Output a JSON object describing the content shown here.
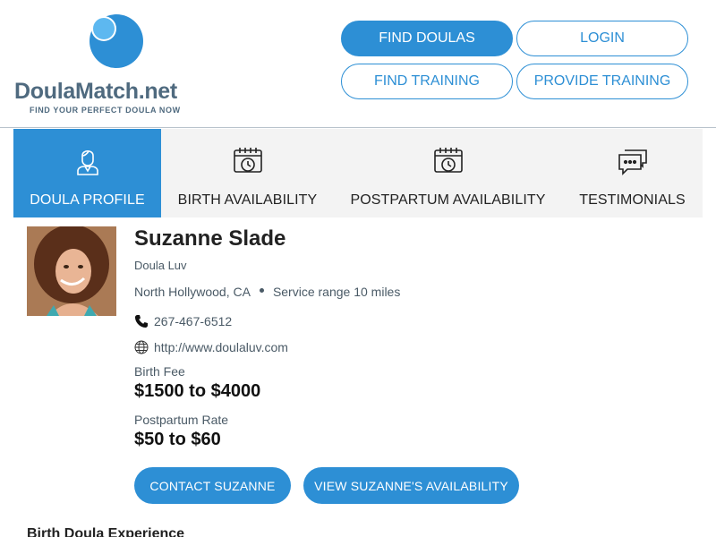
{
  "header": {
    "logo": {
      "brand": "DoulaMatch",
      "tld": ".net",
      "tagline": "FIND YOUR PERFECT DOULA NOW"
    },
    "nav": {
      "find_doulas": "FIND DOULAS",
      "login": "LOGIN",
      "find_training": "FIND TRAINING",
      "provide_training": "PROVIDE TRAINING"
    }
  },
  "tabs": [
    {
      "label": "DOULA PROFILE",
      "icon": "doula-person-icon",
      "active": true
    },
    {
      "label": "BIRTH AVAILABILITY",
      "icon": "calendar-clock-icon",
      "active": false
    },
    {
      "label": "POSTPARTUM AVAILABILITY",
      "icon": "calendar-clock-icon",
      "active": false
    },
    {
      "label": "TESTIMONIALS",
      "icon": "chat-bubbles-icon",
      "active": false
    }
  ],
  "profile": {
    "name": "Suzanne Slade",
    "business": "Doula Luv",
    "location": "North Hollywood, CA",
    "service_range": "Service range 10 miles",
    "phone": "267-467-6512",
    "website": "http://www.doulaluv.com",
    "birth_fee_label": "Birth Fee",
    "birth_fee": "$1500 to $4000",
    "postpartum_label": "Postpartum Rate",
    "postpartum_rate": "$50 to $60",
    "contact_button": "CONTACT SUZANNE",
    "availability_button": "VIEW SUZANNE'S AVAILABILITY"
  },
  "sections": {
    "experience_title": "Birth Doula Experience"
  },
  "colors": {
    "accent": "#2d8fd5",
    "logo_text": "#4f6a7f",
    "tab_bg": "#f3f3f3"
  }
}
